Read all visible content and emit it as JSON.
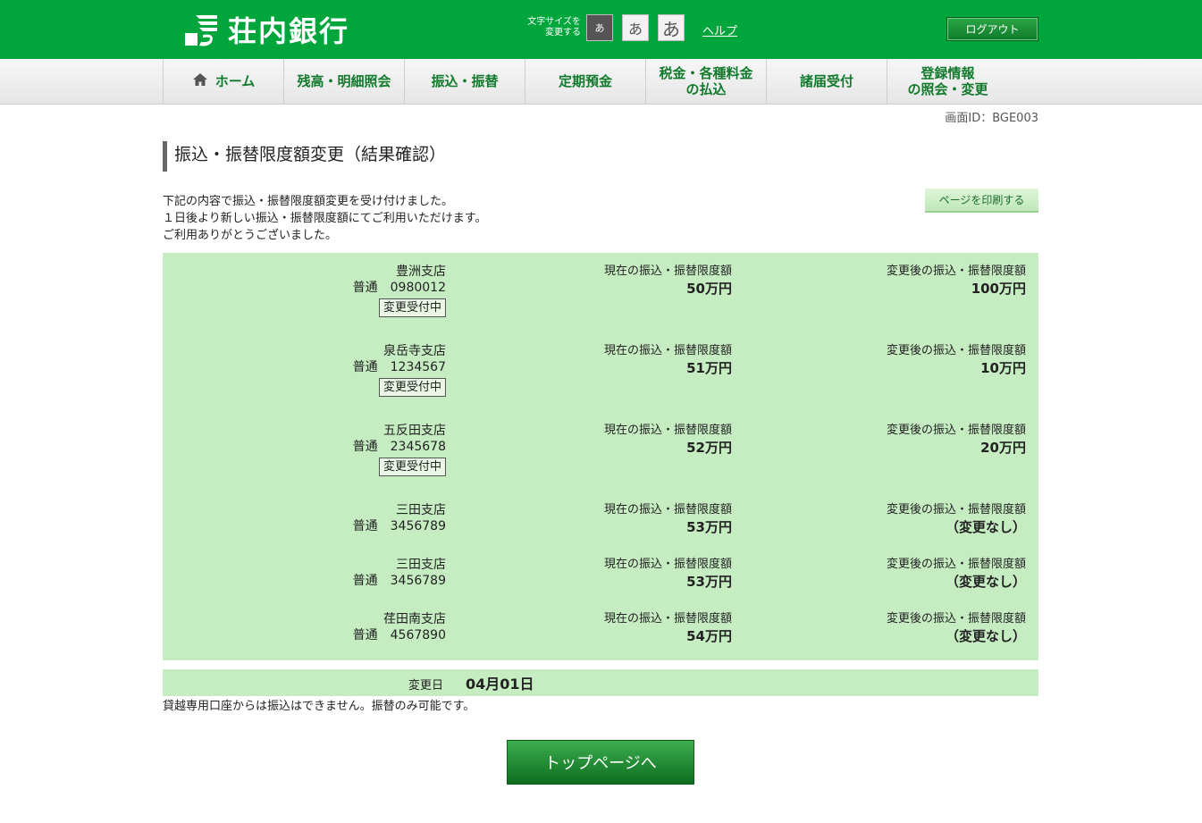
{
  "header": {
    "bank_name": "荘内銀行",
    "font_size_label_line1": "文字サイズを",
    "font_size_label_line2": "変更する",
    "font_small": "あ",
    "font_mid": "あ",
    "font_large": "あ",
    "help": "ヘルプ",
    "logout": "ログアウト"
  },
  "nav": {
    "home": "ホーム",
    "balance": "残高・明細照会",
    "transfer": "振込・振替",
    "time_deposit": "定期預金",
    "tax_line1": "税金・各種料金",
    "tax_line2": "の払込",
    "notices": "諸届受付",
    "registration_line1": "登録情報",
    "registration_line2": "の照会・変更"
  },
  "screen_id": "画面ID：BGE003",
  "page_title": "振込・振替限度額変更（結果確認）",
  "notice_lines": [
    "下記の内容で振込・振替限度額変更を受け付けました。",
    "１日後より新しい振込・振替限度額にてご利用いただけます。",
    "ご利用ありがとうございました。"
  ],
  "print_button": "ページを印刷する",
  "labels": {
    "current_limit": "現在の振込・振替限度額",
    "new_limit": "変更後の振込・振替限度額",
    "account_type": "普通"
  },
  "accounts": [
    {
      "branch": "豊洲支店",
      "number": "0980012",
      "badge": "変更受付中",
      "current": "50万円",
      "new": "100万円"
    },
    {
      "branch": "泉岳寺支店",
      "number": "1234567",
      "badge": "変更受付中",
      "current": "51万円",
      "new": "10万円"
    },
    {
      "branch": "五反田支店",
      "number": "2345678",
      "badge": "変更受付中",
      "current": "52万円",
      "new": "20万円"
    },
    {
      "branch": "三田支店",
      "number": "3456789",
      "badge": "",
      "current": "53万円",
      "new": "（変更なし）"
    },
    {
      "branch": "三田支店",
      "number": "3456789",
      "badge": "",
      "current": "53万円",
      "new": "（変更なし）"
    },
    {
      "branch": "荏田南支店",
      "number": "4567890",
      "badge": "",
      "current": "54万円",
      "new": "（変更なし）"
    }
  ],
  "change_date_label": "変更日",
  "change_date_value": "04月01日",
  "footnote": "貸越専用口座からは振込はできません。振替のみ可能です。",
  "top_button": "トップページへ",
  "colors": {
    "brand_green": "#00a63c",
    "panel_green": "#c6ecc2",
    "nav_text": "#127a2c"
  }
}
